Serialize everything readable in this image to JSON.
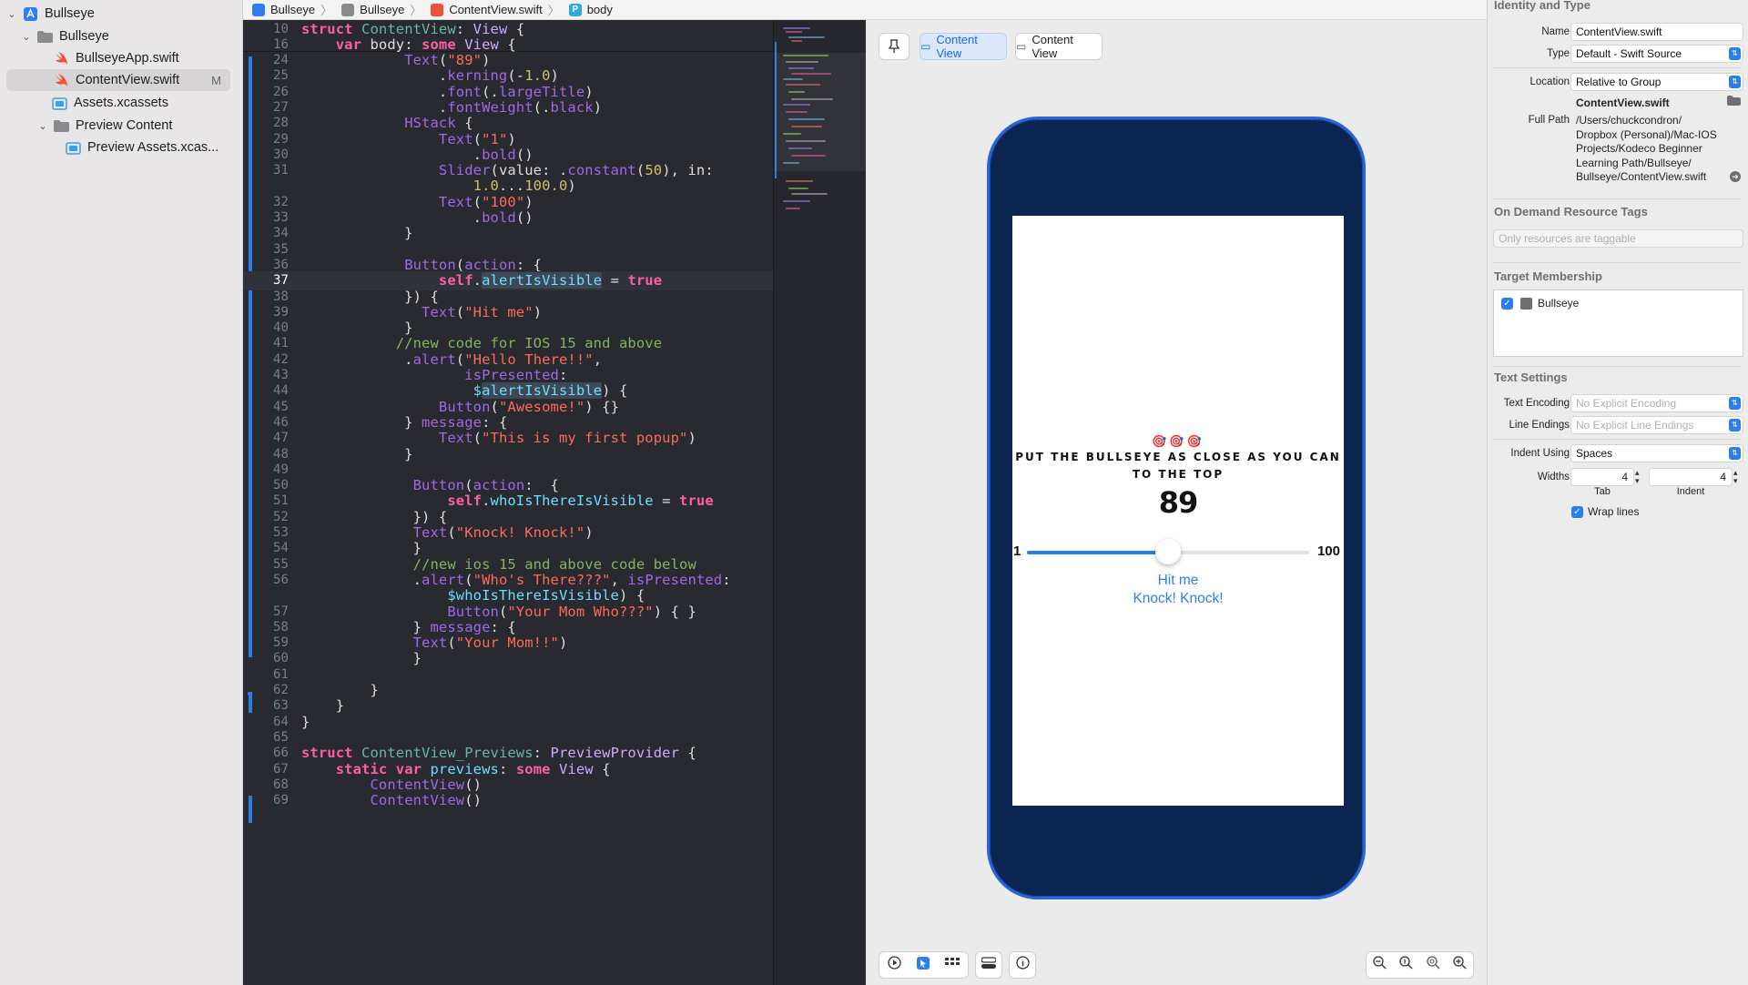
{
  "navigator": {
    "items": [
      {
        "label": "Bullseye",
        "kind": "project"
      },
      {
        "label": "Bullseye",
        "kind": "folder"
      },
      {
        "label": "BullseyeApp.swift",
        "kind": "swift"
      },
      {
        "label": "ContentView.swift",
        "kind": "swift",
        "badge": "M"
      },
      {
        "label": "Assets.xcassets",
        "kind": "assets"
      },
      {
        "label": "Preview Content",
        "kind": "folder"
      },
      {
        "label": "Preview Assets.xcas...",
        "kind": "assets"
      }
    ]
  },
  "jumpbar": {
    "crumbs": [
      "Bullseye",
      "Bullseye",
      "ContentView.swift",
      "body"
    ]
  },
  "editor": {
    "current_line": "37",
    "sticky_lines": [
      "10",
      "16"
    ],
    "lines": [
      {
        "n": "10",
        "html": "<span class='kw'>struct</span> <span class='vr'>ContentView</span>: <span class='ty'>View</span> {"
      },
      {
        "n": "16",
        "html": "    <span class='kw'>var</span> body: <span class='kw'>some</span> <span class='ty'>View</span> {"
      },
      {
        "n": "24",
        "html": "            <span class='fn'>Text</span>(<span class='st'>\"89\"</span>)"
      },
      {
        "n": "25",
        "html": "                .<span class='fn'>kerning</span>(-<span class='nm'>1.0</span>)"
      },
      {
        "n": "26",
        "html": "                .<span class='fn'>font</span>(.<span class='fn'>largeTitle</span>)"
      },
      {
        "n": "27",
        "html": "                .<span class='fn'>fontWeight</span>(.<span class='fn'>black</span>)"
      },
      {
        "n": "28",
        "html": "            <span class='fn'>HStack</span> {"
      },
      {
        "n": "29",
        "html": "                <span class='fn'>Text</span>(<span class='st'>\"1\"</span>)"
      },
      {
        "n": "30",
        "html": "                    .<span class='fn'>bold</span>()"
      },
      {
        "n": "31",
        "html": "                <span class='fn'>Slider</span>(value: .<span class='fn'>constant</span>(<span class='nm'>50</span>), in:"
      },
      {
        "n": "",
        "html": "                    <span class='nm'>1.0</span>...<span class='nm'>100.0</span>)"
      },
      {
        "n": "32",
        "html": "                <span class='fn'>Text</span>(<span class='st'>\"100\"</span>)"
      },
      {
        "n": "33",
        "html": "                    .<span class='fn'>bold</span>()"
      },
      {
        "n": "34",
        "html": "            }"
      },
      {
        "n": "35",
        "html": ""
      },
      {
        "n": "36",
        "html": "            <span class='fn'>Button</span>(<span class='fn'>action</span>: {"
      },
      {
        "n": "37",
        "html": "                <span class='kw'>self</span>.<span class='pr hl'>alertIsVisible</span> = <span class='kw'>true</span>"
      },
      {
        "n": "38",
        "html": "            }) {"
      },
      {
        "n": "39",
        "html": "              <span class='fn'>Text</span>(<span class='st'>\"Hit me\"</span>)"
      },
      {
        "n": "40",
        "html": "            }"
      },
      {
        "n": "41",
        "html": "           <span class='cm'>//new code for IOS 15 and above</span>"
      },
      {
        "n": "42",
        "html": "            .<span class='fn'>alert</span>(<span class='st'>\"Hello There!!\"</span>,"
      },
      {
        "n": "43",
        "html": "                   <span class='fn'>isPresented</span>:"
      },
      {
        "n": "44",
        "html": "                    <span class='pr'>$</span><span class='pr hl'>alertIsVisible</span>) {"
      },
      {
        "n": "45",
        "html": "                <span class='fn'>Button</span>(<span class='st'>\"Awesome!\"</span>) {}"
      },
      {
        "n": "46",
        "html": "            } <span class='fn'>message</span>: {"
      },
      {
        "n": "47",
        "html": "                <span class='fn'>Text</span>(<span class='st'>\"This is my first popup\"</span>)"
      },
      {
        "n": "48",
        "html": "            }"
      },
      {
        "n": "49",
        "html": ""
      },
      {
        "n": "50",
        "html": "             <span class='fn'>Button</span>(<span class='fn'>action</span>:  {"
      },
      {
        "n": "51",
        "html": "                 <span class='kw'>self</span>.<span class='pr'>whoIsThereIsVisible</span> = <span class='kw'>true</span>"
      },
      {
        "n": "52",
        "html": "             }) {"
      },
      {
        "n": "53",
        "html": "             <span class='fn'>Text</span>(<span class='st'>\"Knock! Knock!\"</span>)"
      },
      {
        "n": "54",
        "html": "             }"
      },
      {
        "n": "55",
        "html": "             <span class='cm'>//new ios 15 and above code below</span>"
      },
      {
        "n": "56",
        "html": "             .<span class='fn'>alert</span>(<span class='st'>\"Who's There???\"</span>, <span class='fn'>isPresented</span>:"
      },
      {
        "n": "",
        "html": "                 <span class='pr'>$whoIsThereIsVisible</span>) {"
      },
      {
        "n": "57",
        "html": "                 <span class='fn'>Button</span>(<span class='st'>\"Your Mom Who???\"</span>) { }"
      },
      {
        "n": "58",
        "html": "             } <span class='fn'>message</span>: {"
      },
      {
        "n": "59",
        "html": "             <span class='fn'>Text</span>(<span class='st'>\"Your Mom!!\"</span>)"
      },
      {
        "n": "60",
        "html": "             }"
      },
      {
        "n": "61",
        "html": ""
      },
      {
        "n": "62",
        "html": "        }"
      },
      {
        "n": "63",
        "html": "    }"
      },
      {
        "n": "64",
        "html": "}"
      },
      {
        "n": "65",
        "html": ""
      },
      {
        "n": "66",
        "html": "<span class='kw'>struct</span> <span class='vr'>ContentView_Previews</span>: <span class='ty'>PreviewProvider</span> {"
      },
      {
        "n": "67",
        "html": "    <span class='kw'>static</span> <span class='kw'>var</span> <span class='pr'>previews</span>: <span class='kw'>some</span> <span class='ty'>View</span> {"
      },
      {
        "n": "68",
        "html": "        <span class='fn'>ContentView</span>()"
      },
      {
        "n": "69",
        "html": "        <span class='fn'>ContentView</span>()"
      }
    ]
  },
  "canvas": {
    "tabs": [
      "Content View",
      "Content View"
    ],
    "preview": {
      "targets": "🎯🎯🎯",
      "headline": "PUT THE BULLSEYE AS CLOSE AS YOU CAN TO THE TOP",
      "number": "89",
      "slider_min": "1",
      "slider_max": "100",
      "slider_value_fraction": 0.5,
      "button1": "Hit me",
      "button2": "Knock! Knock!"
    }
  },
  "inspector": {
    "identity_title": "Identity and Type",
    "name_label": "Name",
    "name_value": "ContentView.swift",
    "type_label": "Type",
    "type_value": "Default - Swift Source",
    "location_label": "Location",
    "location_value": "Relative to Group",
    "location_file": "ContentView.swift",
    "fullpath_label": "Full Path",
    "fullpath_lines": [
      "/Users/chuckcondron/",
      "Dropbox (Personal)/Mac-IOS",
      "Projects/Kodeco Beginner",
      "Learning Path/Bullseye/",
      "Bullseye/ContentView.swift"
    ],
    "odr_title": "On Demand Resource Tags",
    "odr_placeholder": "Only resources are taggable",
    "target_title": "Target Membership",
    "target_name": "Bullseye",
    "text_settings_title": "Text Settings",
    "encoding_label": "Text Encoding",
    "encoding_value": "No Explicit Encoding",
    "endings_label": "Line Endings",
    "endings_value": "No Explicit Line Endings",
    "indent_label": "Indent Using",
    "indent_value": "Spaces",
    "widths_label": "Widths",
    "tab_value": "4",
    "indent_width_value": "4",
    "tab_caption": "Tab",
    "indent_caption": "Indent",
    "wrap_label": "Wrap lines"
  }
}
